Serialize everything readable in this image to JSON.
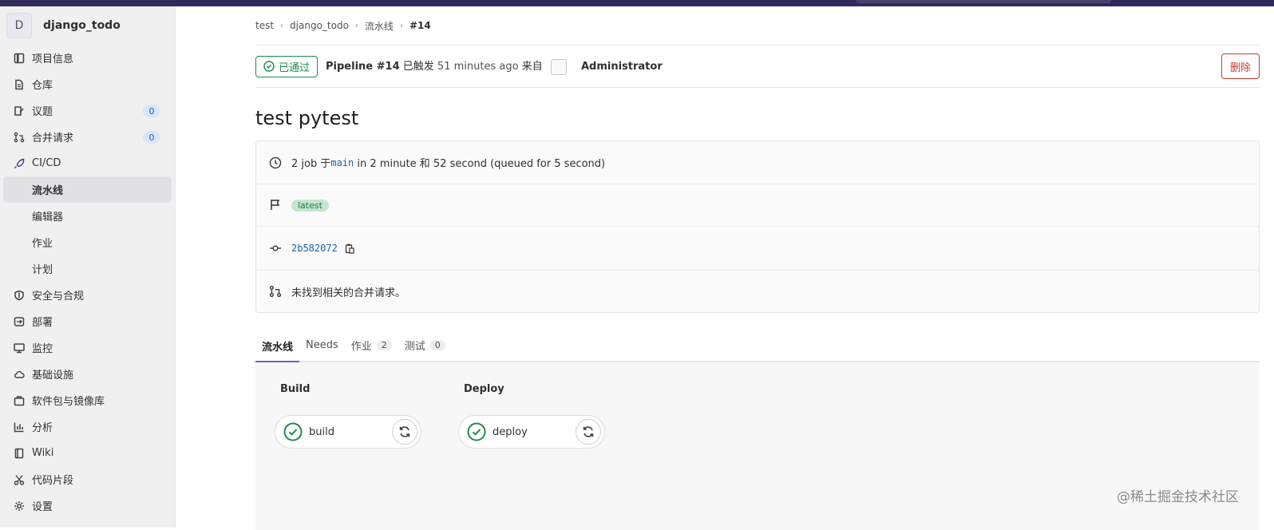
{
  "project": {
    "avatar_letter": "D",
    "name": "django_todo"
  },
  "sidebar": {
    "items": [
      {
        "label": "项目信息",
        "icon": "project-info-icon"
      },
      {
        "label": "仓库",
        "icon": "repository-icon"
      },
      {
        "label": "议题",
        "icon": "issues-icon",
        "badge": "0"
      },
      {
        "label": "合并请求",
        "icon": "merge-request-icon",
        "badge": "0"
      },
      {
        "label": "CI/CD",
        "icon": "rocket-icon"
      },
      {
        "label": "流水线",
        "sub": true,
        "active": true
      },
      {
        "label": "编辑器",
        "sub": true
      },
      {
        "label": "作业",
        "sub": true
      },
      {
        "label": "计划",
        "sub": true
      },
      {
        "label": "安全与合规",
        "icon": "shield-icon"
      },
      {
        "label": "部署",
        "icon": "deploy-icon"
      },
      {
        "label": "监控",
        "icon": "monitor-icon"
      },
      {
        "label": "基础设施",
        "icon": "cloud-icon"
      },
      {
        "label": "软件包与镜像库",
        "icon": "package-icon"
      },
      {
        "label": "分析",
        "icon": "chart-icon"
      },
      {
        "label": "Wiki",
        "icon": "book-icon"
      },
      {
        "label": "代码片段",
        "icon": "scissors-icon"
      },
      {
        "label": "设置",
        "icon": "gear-icon"
      }
    ]
  },
  "breadcrumb": [
    "test",
    "django_todo",
    "流水线",
    "#14"
  ],
  "pipeline": {
    "status": "已通过",
    "name": "Pipeline #14",
    "triggered": "已触发",
    "time": "51 minutes ago",
    "from": "来自",
    "user": "Administrator",
    "delete_label": "删除",
    "title": "test pytest"
  },
  "info": {
    "jobs_prefix": "2 job 于",
    "branch": "main",
    "duration": "in 2 minute 和 52 second (queued for 5 second)",
    "tag": "latest",
    "commit": "2b582072",
    "mr_text": "未找到相关的合并请求。"
  },
  "tabs": [
    {
      "label": "流水线",
      "active": true
    },
    {
      "label": "Needs"
    },
    {
      "label": "作业",
      "count": "2"
    },
    {
      "label": "测试",
      "count": "0"
    }
  ],
  "stages": [
    {
      "title": "Build",
      "job": "build"
    },
    {
      "title": "Deploy",
      "job": "deploy"
    }
  ],
  "watermark": "@稀土掘金技术社区",
  "colors": {
    "success": "#1f8a4c",
    "danger": "#c63c2b",
    "link": "#1f5fa8",
    "topbar": "#2e2a5a"
  }
}
